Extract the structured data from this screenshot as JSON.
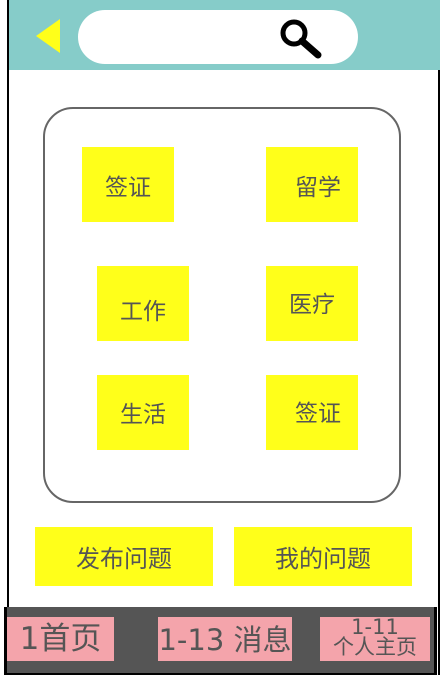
{
  "header": {
    "search_placeholder": ""
  },
  "categories": [
    {
      "label": "签证"
    },
    {
      "label": "留学"
    },
    {
      "label": "工作"
    },
    {
      "label": "医疗"
    },
    {
      "label": "生活"
    },
    {
      "label": "签证"
    }
  ],
  "actions": {
    "post_question": "发布问题",
    "my_questions": "我的问题"
  },
  "tabbar": {
    "home": "1首页",
    "messages": "1-13 消息",
    "profile_id": "1-11",
    "profile": "个人主页"
  },
  "colors": {
    "header": "#86ccc9",
    "accent": "#ffff1a",
    "tab": "#f4a4ab",
    "tabbar": "#555555",
    "text": "#555555"
  }
}
